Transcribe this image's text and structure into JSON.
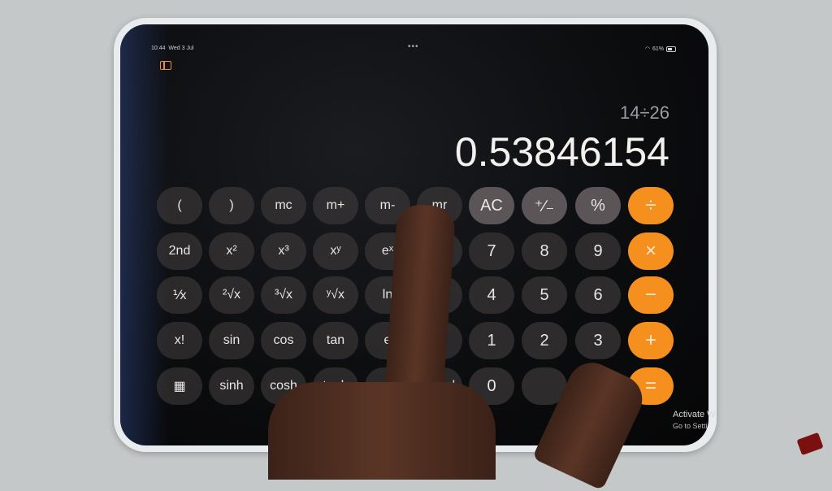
{
  "status_bar": {
    "time": "10:44",
    "date": "Wed 3 Jul",
    "battery": "61%",
    "dots": "•••"
  },
  "toolbar": {
    "sidebar_icon": "sidebar-icon"
  },
  "display": {
    "expression": "14÷26",
    "result": "0.53846154"
  },
  "keys": [
    [
      {
        "label": "(",
        "type": "sci"
      },
      {
        "label": ")",
        "type": "sci"
      },
      {
        "label": "mc",
        "type": "sci"
      },
      {
        "label": "m+",
        "type": "sci"
      },
      {
        "label": "m-",
        "type": "sci"
      },
      {
        "label": "mr",
        "type": "sci"
      },
      {
        "label": "AC",
        "type": "fn"
      },
      {
        "label": "⁺∕₋",
        "type": "fn"
      },
      {
        "label": "%",
        "type": "fn"
      },
      {
        "label": "÷",
        "type": "op"
      }
    ],
    [
      {
        "label": "2nd",
        "type": "sci"
      },
      {
        "label": "x²",
        "type": "sci"
      },
      {
        "label": "x³",
        "type": "sci"
      },
      {
        "label": "xʸ",
        "type": "sci"
      },
      {
        "label": "eˣ",
        "type": "sci"
      },
      {
        "label": "",
        "type": "sci"
      },
      {
        "label": "7",
        "type": "num"
      },
      {
        "label": "8",
        "type": "num"
      },
      {
        "label": "9",
        "type": "num"
      },
      {
        "label": "×",
        "type": "op"
      }
    ],
    [
      {
        "label": "⅟x",
        "type": "sci"
      },
      {
        "label": "²√x",
        "type": "sci"
      },
      {
        "label": "³√x",
        "type": "sci"
      },
      {
        "label": "ʸ√x",
        "type": "sci"
      },
      {
        "label": "ln",
        "type": "sci"
      },
      {
        "label": "",
        "type": "sci"
      },
      {
        "label": "4",
        "type": "num"
      },
      {
        "label": "5",
        "type": "num"
      },
      {
        "label": "6",
        "type": "num"
      },
      {
        "label": "−",
        "type": "op"
      }
    ],
    [
      {
        "label": "x!",
        "type": "sci"
      },
      {
        "label": "sin",
        "type": "sci"
      },
      {
        "label": "cos",
        "type": "sci"
      },
      {
        "label": "tan",
        "type": "sci"
      },
      {
        "label": "e",
        "type": "sci"
      },
      {
        "label": "",
        "type": "sci"
      },
      {
        "label": "1",
        "type": "num"
      },
      {
        "label": "2",
        "type": "num"
      },
      {
        "label": "3",
        "type": "num"
      },
      {
        "label": "+",
        "type": "op"
      }
    ],
    [
      {
        "label": "▦",
        "type": "sci",
        "icon": "calculator-icon"
      },
      {
        "label": "sinh",
        "type": "sci"
      },
      {
        "label": "cosh",
        "type": "sci"
      },
      {
        "label": "tanh",
        "type": "sci"
      },
      {
        "label": "",
        "type": "sci"
      },
      {
        "label": "Rand",
        "type": "sci"
      },
      {
        "label": "0",
        "type": "num"
      },
      {
        "label": "",
        "type": "num"
      },
      {
        "label": "",
        "type": "num",
        "hidden": true
      },
      {
        "label": "=",
        "type": "op"
      }
    ]
  ],
  "watermark": {
    "line1": "Activate W",
    "line2": "Go to Setti"
  },
  "colors": {
    "operator": "#f5901e",
    "function": "#5b5557",
    "number": "#2e2b2c",
    "accent": "#f0902a"
  }
}
